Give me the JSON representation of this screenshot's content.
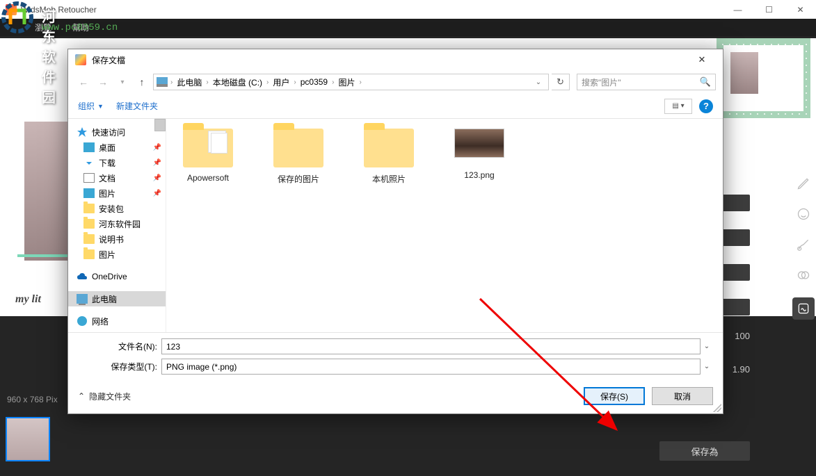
{
  "app": {
    "title": "WidsMob Retoucher",
    "menu": {
      "browse": "瀏覽",
      "help": "幫助"
    }
  },
  "watermark": {
    "name": "河东软件园",
    "url": "www.pc0359.cn"
  },
  "canvas": {
    "dims": "960 x 768 Pix",
    "caption": "my lit"
  },
  "right_panel": {
    "val_opacity": "100",
    "val_scale": "1.90",
    "save_as": "保存為"
  },
  "window_controls": {
    "min": "—",
    "max": "☐",
    "close": "✕"
  },
  "dialog": {
    "title": "保存文檔",
    "breadcrumbs": [
      "此电脑",
      "本地磁盘 (C:)",
      "用户",
      "pc0359",
      "图片"
    ],
    "search_placeholder": "搜索\"图片\"",
    "organize": "组织",
    "new_folder": "新建文件夹",
    "tree": {
      "quick_access": "快速访问",
      "desktop": "桌面",
      "downloads": "下载",
      "documents": "文档",
      "pictures": "图片",
      "install_pkg": "安装包",
      "hedong": "河东软件园",
      "manual": "说明书",
      "pictures2": "图片",
      "onedrive": "OneDrive",
      "this_pc": "此电脑",
      "network": "网络"
    },
    "items": [
      {
        "name": "Apowersoft",
        "type": "folder-doc"
      },
      {
        "name": "保存的图片",
        "type": "folder"
      },
      {
        "name": "本机照片",
        "type": "folder"
      },
      {
        "name": "123.png",
        "type": "image"
      }
    ],
    "filename_label": "文件名(N):",
    "filename_value": "123",
    "filetype_label": "保存类型(T):",
    "filetype_value": "PNG image (*.png)",
    "hide_folders": "隐藏文件夹",
    "save_btn": "保存(S)",
    "cancel_btn": "取消"
  }
}
